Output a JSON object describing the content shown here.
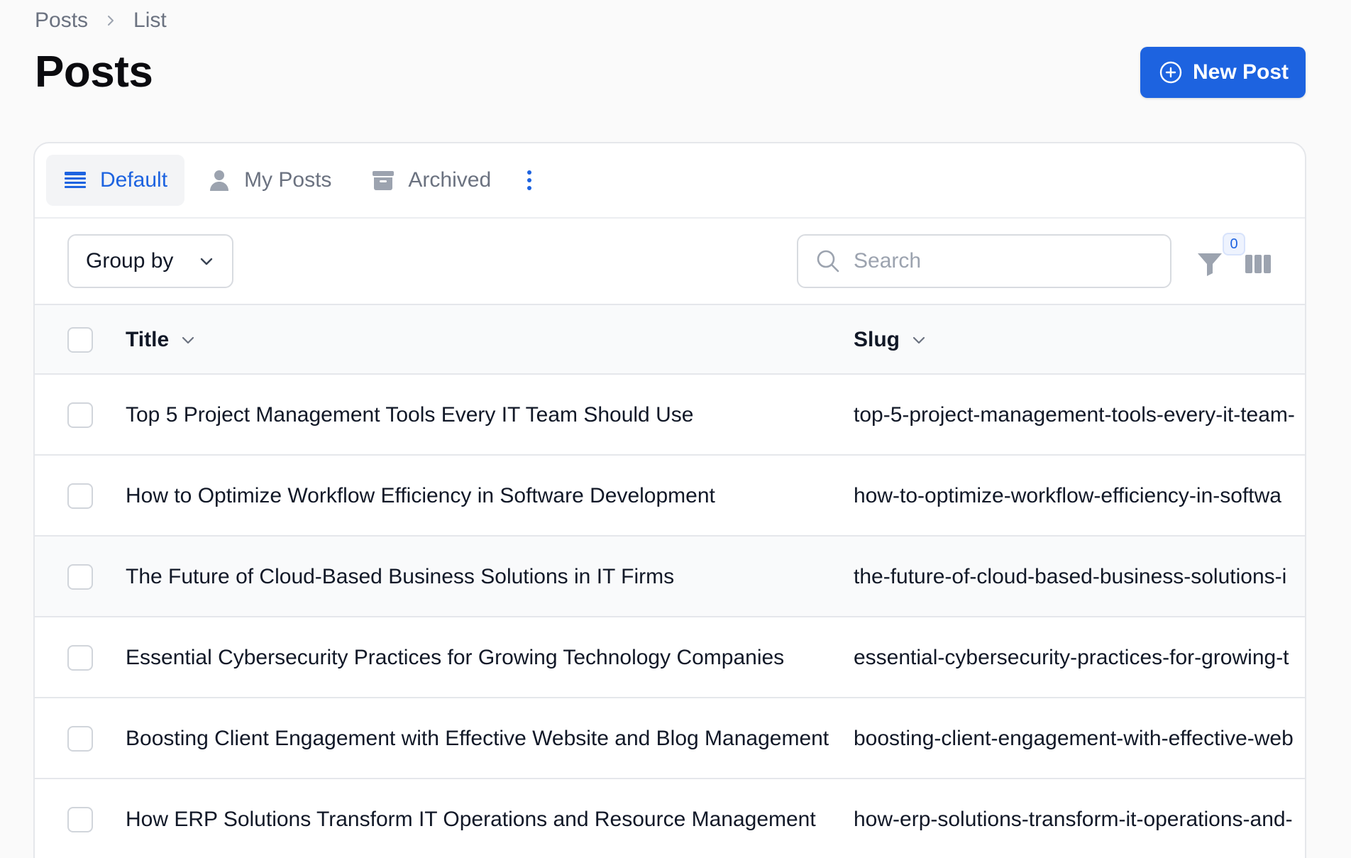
{
  "breadcrumb": {
    "items": [
      "Posts",
      "List"
    ]
  },
  "page_title": "Posts",
  "new_post_button": {
    "label": "New Post",
    "icon": "plus-circle-icon"
  },
  "tabs": [
    {
      "label": "Default",
      "icon": "list-icon",
      "active": true
    },
    {
      "label": "My Posts",
      "icon": "user-icon",
      "active": false
    },
    {
      "label": "Archived",
      "icon": "archive-icon",
      "active": false
    }
  ],
  "toolbar": {
    "group_by_label": "Group by",
    "search_placeholder": "Search",
    "search_value": "",
    "filter_count": "0"
  },
  "table": {
    "columns": [
      "Title",
      "Slug"
    ],
    "rows": [
      {
        "title": "Top 5 Project Management Tools Every IT Team Should Use",
        "slug": "top-5-project-management-tools-every-it-team-"
      },
      {
        "title": "How to Optimize Workflow Efficiency in Software Development",
        "slug": "how-to-optimize-workflow-efficiency-in-softwa"
      },
      {
        "title": "The Future of Cloud-Based Business Solutions in IT Firms",
        "slug": "the-future-of-cloud-based-business-solutions-i"
      },
      {
        "title": "Essential Cybersecurity Practices for Growing Technology Companies",
        "slug": "essential-cybersecurity-practices-for-growing-t"
      },
      {
        "title": "Boosting Client Engagement with Effective Website and Blog Management",
        "slug": "boosting-client-engagement-with-effective-web"
      },
      {
        "title": "How ERP Solutions Transform IT Operations and Resource Management",
        "slug": "how-erp-solutions-transform-it-operations-and-"
      }
    ]
  },
  "colors": {
    "primary": "#1d63e0",
    "muted_text": "#6b7280",
    "border": "#e5e7eb"
  }
}
